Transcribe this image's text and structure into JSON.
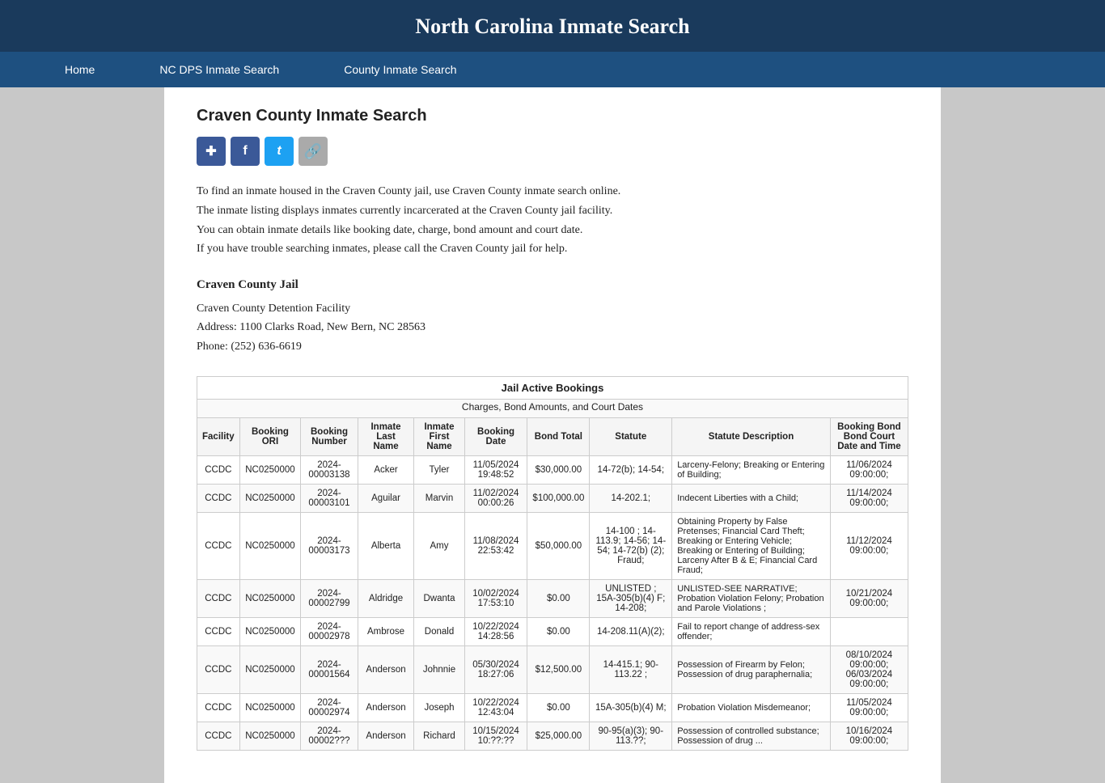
{
  "header": {
    "title": "North Carolina Inmate Search"
  },
  "nav": {
    "items": [
      {
        "label": "Home",
        "id": "home"
      },
      {
        "label": "NC DPS Inmate Search",
        "id": "nc-dps"
      },
      {
        "label": "County Inmate Search",
        "id": "county"
      }
    ]
  },
  "page": {
    "title": "Craven County Inmate Search",
    "description_lines": [
      "To find an inmate housed in the Craven County jail, use Craven County inmate search online.",
      "The inmate listing displays inmates currently incarcerated at the Craven County jail facility.",
      "You can obtain inmate details like booking date, charge, bond amount and court date.",
      "If you have trouble searching inmates, please call the Craven County jail for help."
    ],
    "jail_title": "Craven County Jail",
    "jail_name": "Craven County Detention Facility",
    "jail_address": "Address: 1100 Clarks Road, New Bern, NC 28563",
    "jail_phone": "Phone: (252) 636-6619"
  },
  "share_icons": [
    {
      "id": "share",
      "label": "✚",
      "class": "icon-share",
      "title": "Share"
    },
    {
      "id": "facebook",
      "label": "f",
      "class": "icon-fb",
      "title": "Facebook"
    },
    {
      "id": "twitter",
      "label": "t",
      "class": "icon-tw",
      "title": "Twitter"
    },
    {
      "id": "link",
      "label": "🔗",
      "class": "icon-link",
      "title": "Copy Link"
    }
  ],
  "table": {
    "main_title": "Jail Active Bookings",
    "sub_title": "Charges, Bond Amounts, and Court Dates",
    "columns": [
      "Facility",
      "Booking ORI",
      "Booking Number",
      "Inmate Last Name",
      "Inmate First Name",
      "Booking Date",
      "Bond Total",
      "Statute",
      "Statute Description",
      "Booking Bond Bond Court Date and Time"
    ],
    "rows": [
      {
        "facility": "CCDC",
        "ori": "NC0250000",
        "booking_number": "2024-00003138",
        "last_name": "Acker",
        "first_name": "Tyler",
        "booking_date": "11/05/2024 19:48:52",
        "bond_total": "$30,000.00",
        "statute": "14-72(b); 14-54;",
        "description": "Larceny-Felony; Breaking or Entering of Building;",
        "court_date": "11/06/2024 09:00:00;"
      },
      {
        "facility": "CCDC",
        "ori": "NC0250000",
        "booking_number": "2024-00003101",
        "last_name": "Aguilar",
        "first_name": "Marvin",
        "booking_date": "11/02/2024 00:00:26",
        "bond_total": "$100,000.00",
        "statute": "14-202.1;",
        "description": "Indecent Liberties with a Child;",
        "court_date": "11/14/2024 09:00:00;"
      },
      {
        "facility": "CCDC",
        "ori": "NC0250000",
        "booking_number": "2024-00003173",
        "last_name": "Alberta",
        "first_name": "Amy",
        "booking_date": "11/08/2024 22:53:42",
        "bond_total": "$50,000.00",
        "statute": "14-100 ; 14-113.9; 14-56; 14-54; 14-72(b) (2); Fraud;",
        "description": "Obtaining Property by False Pretenses; Financial Card Theft; Breaking or Entering Vehicle; Breaking or Entering of Building; Larceny After B & E; Financial Card Fraud;",
        "court_date": "11/12/2024 09:00:00;"
      },
      {
        "facility": "CCDC",
        "ori": "NC0250000",
        "booking_number": "2024-00002799",
        "last_name": "Aldridge",
        "first_name": "Dwanta",
        "booking_date": "10/02/2024 17:53:10",
        "bond_total": "$0.00",
        "statute": "UNLISTED ; 15A-305(b)(4) F; 14-208;",
        "description": "UNLISTED-SEE NARRATIVE; Probation Violation Felony; Probation and Parole Violations ;",
        "court_date": "10/21/2024 09:00:00;"
      },
      {
        "facility": "CCDC",
        "ori": "NC0250000",
        "booking_number": "2024-00002978",
        "last_name": "Ambrose",
        "first_name": "Donald",
        "booking_date": "10/22/2024 14:28:56",
        "bond_total": "$0.00",
        "statute": "14-208.11(A)(2);",
        "description": "Fail to report change of address-sex offender;",
        "court_date": ""
      },
      {
        "facility": "CCDC",
        "ori": "NC0250000",
        "booking_number": "2024-00001564",
        "last_name": "Anderson",
        "first_name": "Johnnie",
        "booking_date": "05/30/2024 18:27:06",
        "bond_total": "$12,500.00",
        "statute": "14-415.1; 90-113.22 ;",
        "description": "Possession of Firearm by Felon; Possession of drug paraphernalia;",
        "court_date": "08/10/2024 09:00:00; 06/03/2024 09:00:00;"
      },
      {
        "facility": "CCDC",
        "ori": "NC0250000",
        "booking_number": "2024-00002974",
        "last_name": "Anderson",
        "first_name": "Joseph",
        "booking_date": "10/22/2024 12:43:04",
        "bond_total": "$0.00",
        "statute": "15A-305(b)(4) M;",
        "description": "Probation Violation Misdemeanor;",
        "court_date": "11/05/2024 09:00:00;"
      },
      {
        "facility": "CCDC",
        "ori": "NC0250000",
        "booking_number": "2024-00002???",
        "last_name": "Anderson",
        "first_name": "Richard",
        "booking_date": "10/15/2024 10:??:??",
        "bond_total": "$25,000.00",
        "statute": "90-95(a)(3); 90-113.??;",
        "description": "Possession of controlled substance; Possession of drug ...",
        "court_date": "10/16/2024 09:00:00;"
      }
    ]
  }
}
